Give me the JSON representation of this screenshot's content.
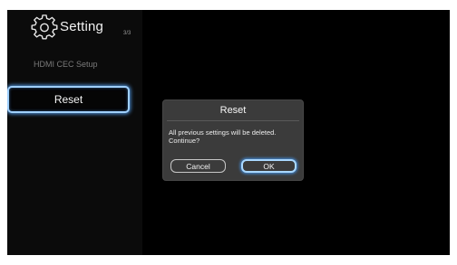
{
  "header": {
    "title": "Setting",
    "icon": "gear-icon",
    "page_indicator": "3/3"
  },
  "sidebar": {
    "items": [
      {
        "label": "HDMI CEC Setup",
        "state": "dimmed"
      },
      {
        "label": "Reset",
        "state": "focused"
      }
    ]
  },
  "dialog": {
    "title": "Reset",
    "message": "All previous settings will be deleted. Continue?",
    "cancel_label": "Cancel",
    "ok_label": "OK",
    "focused_button": "OK"
  },
  "colors": {
    "screen_background": "#000000",
    "sidebar_background": "#0b0b0b",
    "dialog_background": "#3b3b3b",
    "focus_glow": "#a9d8ff",
    "text": "#f5f5f5"
  }
}
